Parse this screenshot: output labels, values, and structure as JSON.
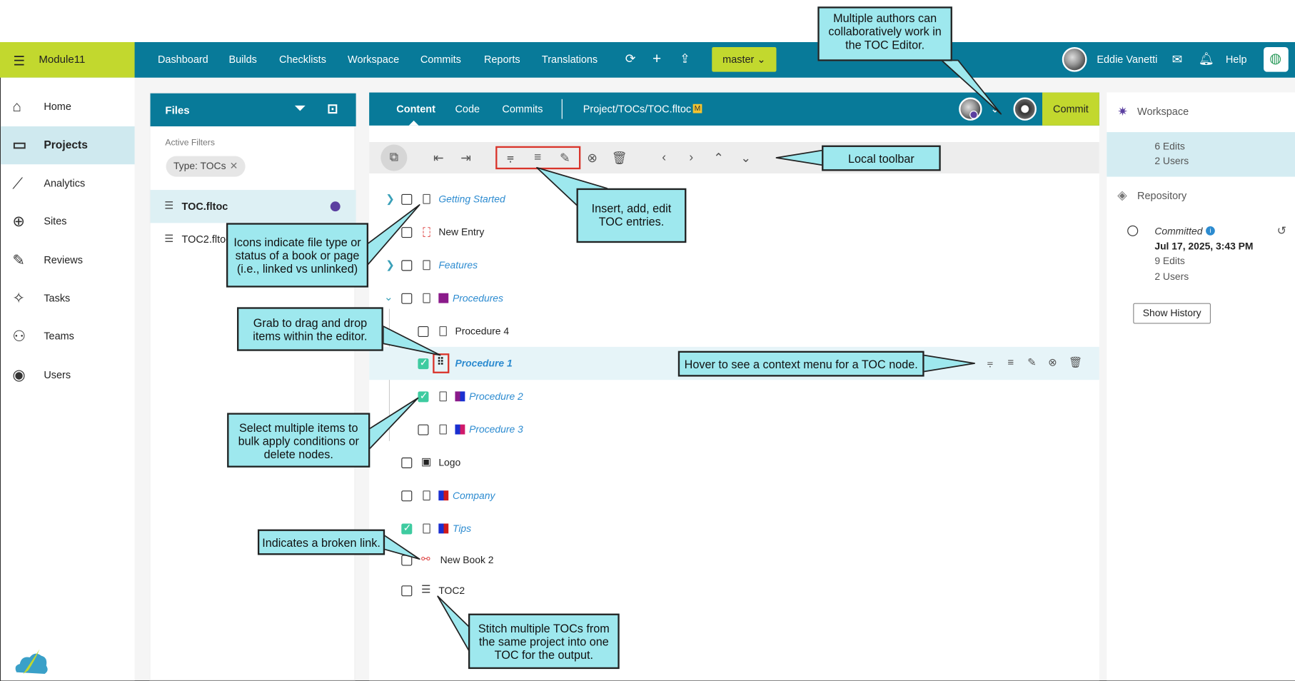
{
  "brand": {
    "name": "Module11"
  },
  "nav": [
    "Dashboard",
    "Builds",
    "Checklists",
    "Workspace",
    "Commits",
    "Reports",
    "Translations"
  ],
  "branch": "master",
  "user": {
    "name": "Eddie Vanetti",
    "help": "Help"
  },
  "sidebar": [
    "Home",
    "Projects",
    "Analytics",
    "Sites",
    "Reviews",
    "Tasks",
    "Teams",
    "Users"
  ],
  "files": {
    "title": "Files",
    "filters_label": "Active Filters",
    "chip": "Type: TOCs",
    "items": [
      "TOC.fltoc",
      "TOC2.fltoc"
    ]
  },
  "content": {
    "tabs": [
      "Content",
      "Code",
      "Commits"
    ],
    "path": "Project/TOCs/TOC.fltoc",
    "badge": "M",
    "commit": "Commit"
  },
  "toc": [
    {
      "label": "Getting Started",
      "linked": true
    },
    {
      "label": "New Entry",
      "linked": false
    },
    {
      "label": "Features",
      "linked": true
    },
    {
      "label": "Procedures",
      "linked": true
    },
    {
      "label": "Procedure 4",
      "linked": false
    },
    {
      "label": "Procedure 1",
      "linked": true
    },
    {
      "label": "Procedure 2",
      "linked": true
    },
    {
      "label": "Procedure 3",
      "linked": true
    },
    {
      "label": "Logo",
      "linked": false
    },
    {
      "label": "Company",
      "linked": true
    },
    {
      "label": "Tips",
      "linked": true
    },
    {
      "label": "New Book 2",
      "linked": false
    },
    {
      "label": "TOC2",
      "linked": false
    }
  ],
  "right": {
    "workspace": "Workspace",
    "ws_edits": "6 Edits",
    "ws_users": "2 Users",
    "repository": "Repository",
    "committed": "Committed",
    "date": "Jul 17, 2025, 3:43 PM",
    "r_edits": "9 Edits",
    "r_users": "2 Users",
    "history": "Show History"
  },
  "callouts": {
    "authors": "Multiple authors can collaboratively work in the TOC Editor.",
    "toolbar": "Local toolbar",
    "insert": "Insert, add, edit TOC entries.",
    "icons": "Icons indicate file type or status of a book or page (i.e., linked vs unlinked)",
    "grab": "Grab to drag and drop items within the editor.",
    "hover": "Hover to see a context menu for a TOC node.",
    "select": "Select multiple items to bulk apply conditions or delete nodes.",
    "broken": "Indicates a broken link.",
    "stitch": "Stitch multiple TOCs from the same project into one TOC for the output."
  },
  "colors": {
    "teal": "#087a99",
    "lime": "#c2d82e",
    "callout": "#9ee8ee",
    "check": "#3ecba0"
  }
}
